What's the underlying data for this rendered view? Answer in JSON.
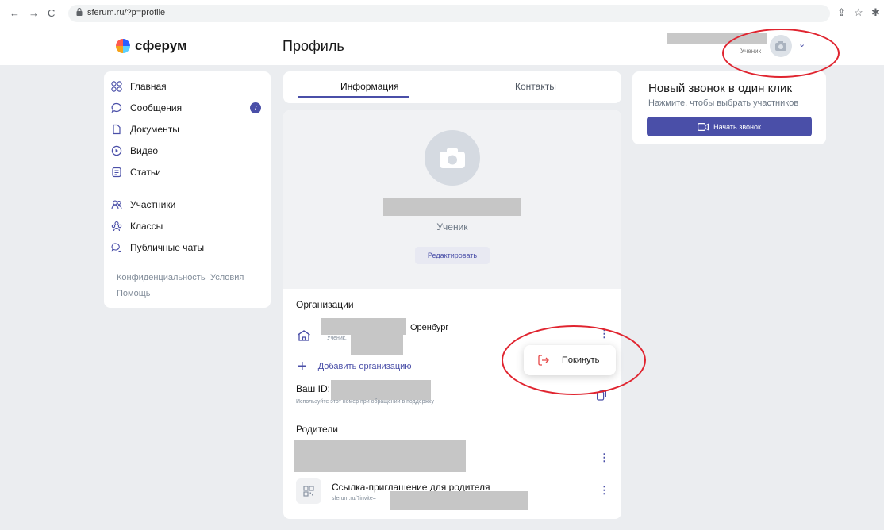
{
  "browser": {
    "url": "sferum.ru/?p=profile",
    "back": "←",
    "forward": "→",
    "reload": "C"
  },
  "header": {
    "logo_text": "сферум",
    "page_title": "Профиль",
    "user_role": "Ученик"
  },
  "sidebar": {
    "items": [
      {
        "label": "Главная",
        "icon": "home-grid-icon"
      },
      {
        "label": "Сообщения",
        "icon": "chat-icon",
        "badge": "7"
      },
      {
        "label": "Документы",
        "icon": "document-icon"
      },
      {
        "label": "Видео",
        "icon": "play-icon"
      },
      {
        "label": "Статьи",
        "icon": "article-icon"
      },
      {
        "label": "Участники",
        "icon": "people-icon"
      },
      {
        "label": "Классы",
        "icon": "classes-icon"
      },
      {
        "label": "Публичные чаты",
        "icon": "public-chat-icon"
      }
    ],
    "footer": {
      "privacy": "Конфиденциальность",
      "terms": "Условия",
      "help": "Помощь"
    }
  },
  "tabs": {
    "info": "Информация",
    "contacts": "Контакты"
  },
  "profile": {
    "role": "Ученик",
    "edit_label": "Редактировать"
  },
  "organizations": {
    "title": "Организации",
    "city": "Оренбург",
    "role_prefix": "Ученик,",
    "add_label": "Добавить организацию"
  },
  "your_id": {
    "label": "Ваш ID:",
    "hint": "Используйте этот номер при обращении в поддержку"
  },
  "parents": {
    "title": "Родители",
    "invite_title": "Ссылка-приглашение для родителя",
    "invite_url": "sferum.ru/?invite="
  },
  "popup": {
    "leave_label": "Покинуть"
  },
  "call_card": {
    "title": "Новый звонок в один клик",
    "subtitle": "Нажмите, чтобы выбрать участников",
    "button_label": "Начать звонок"
  },
  "colors": {
    "accent": "#4a4fa8",
    "annotation": "#e0242f",
    "page_bg": "#ebedf0"
  }
}
